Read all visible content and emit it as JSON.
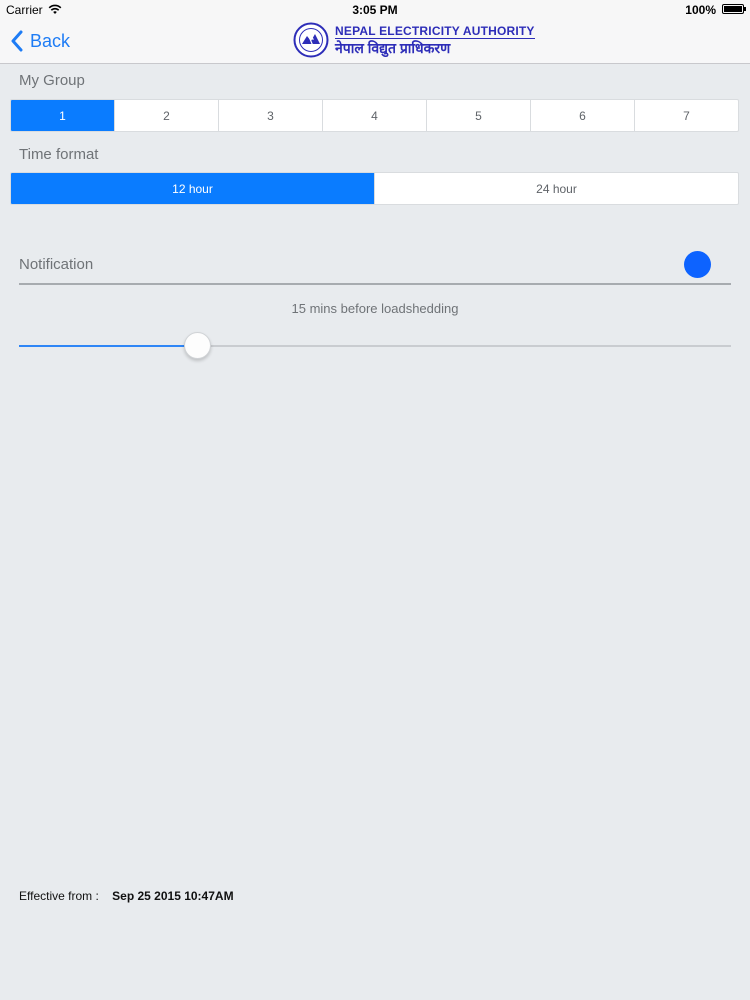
{
  "status_bar": {
    "carrier": "Carrier",
    "time": "3:05 PM",
    "battery": "100%"
  },
  "nav": {
    "back_label": "Back",
    "logo_en": "NEPAL ELECTRICITY AUTHORITY",
    "logo_ne": "नेपाल विद्युत प्राधिकरण"
  },
  "group": {
    "label": "My Group",
    "options": [
      "1",
      "2",
      "3",
      "4",
      "5",
      "6",
      "7"
    ],
    "selected": "1"
  },
  "time_format": {
    "label": "Time format",
    "options": [
      "12 hour",
      "24 hour"
    ],
    "selected": "12 hour"
  },
  "notification": {
    "label": "Notification",
    "slider_caption": "15 mins before loadshedding",
    "slider_fraction": 0.25
  },
  "effective": {
    "label": "Effective from :",
    "value": "Sep 25 2015 10:47AM"
  },
  "colors": {
    "accent": "#0a7cff",
    "toggle": "#0d63ff",
    "logo": "#2d2db8"
  }
}
